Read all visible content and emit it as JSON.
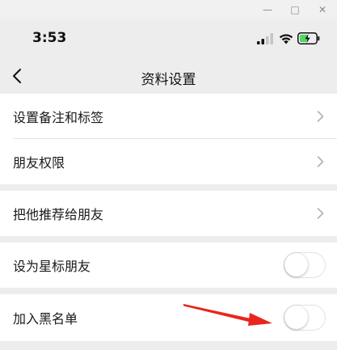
{
  "window": {
    "minimize_glyph": "—",
    "maximize_glyph": "□",
    "close_glyph": "✕"
  },
  "status_bar": {
    "time": "3:53",
    "icons": [
      "signal-icon",
      "wifi-icon",
      "battery-charging-icon"
    ]
  },
  "nav": {
    "title": "资料设置",
    "back_icon": "chevron-left-icon"
  },
  "sections": [
    {
      "items": [
        {
          "label": "设置备注和标签",
          "control": "chevron"
        },
        {
          "label": "朋友权限",
          "control": "chevron"
        }
      ]
    },
    {
      "items": [
        {
          "label": "把他推荐给朋友",
          "control": "chevron"
        }
      ]
    },
    {
      "items": [
        {
          "label": "设为星标朋友",
          "control": "switch",
          "on": false
        }
      ]
    },
    {
      "items": [
        {
          "label": "加入黑名单",
          "control": "switch",
          "on": false
        }
      ]
    }
  ],
  "colors": {
    "background": "#ededed",
    "cell": "#ffffff",
    "annotation_arrow": "#e8261f",
    "battery_charge": "#4cd964"
  }
}
